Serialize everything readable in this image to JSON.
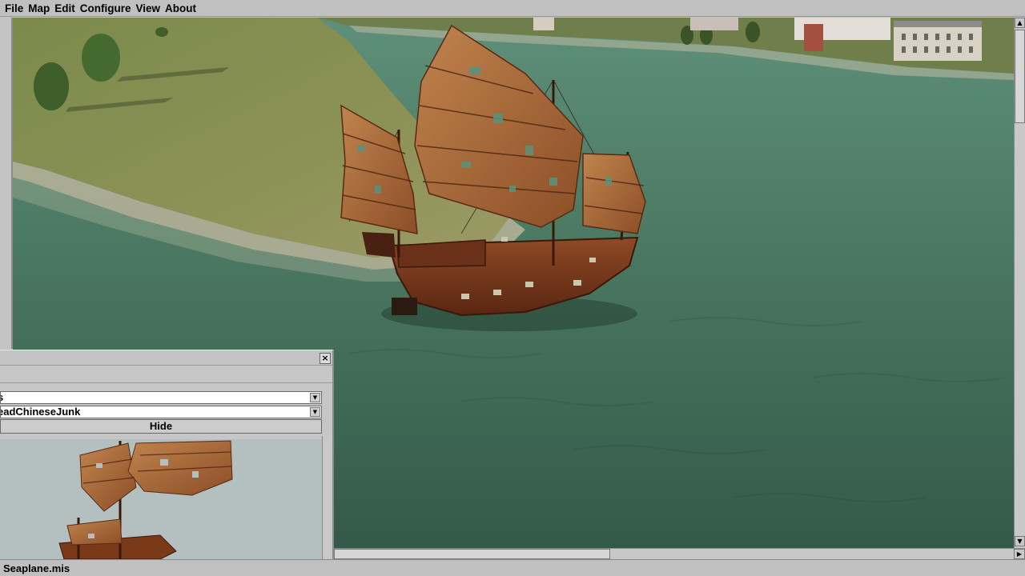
{
  "menu": {
    "items": [
      "File",
      "Map",
      "Edit",
      "Configure",
      "View",
      "About"
    ]
  },
  "object_panel": {
    "category_value": "s",
    "object_value": "eadChineseJunk",
    "hide_label": "Hide",
    "close_glyph": "×"
  },
  "statusbar": {
    "text": "Seaplane.mis"
  },
  "scrollbars": {
    "up_glyph": "▲",
    "down_glyph": "▼",
    "right_glyph": "▶",
    "dropdown_glyph": "▼"
  },
  "colors": {
    "ui_gray": "#c0c0c0",
    "water": "#3e6a55",
    "grass": "#7e8a4a",
    "hull": "#7a3a1a",
    "sail": "#a8683a"
  }
}
